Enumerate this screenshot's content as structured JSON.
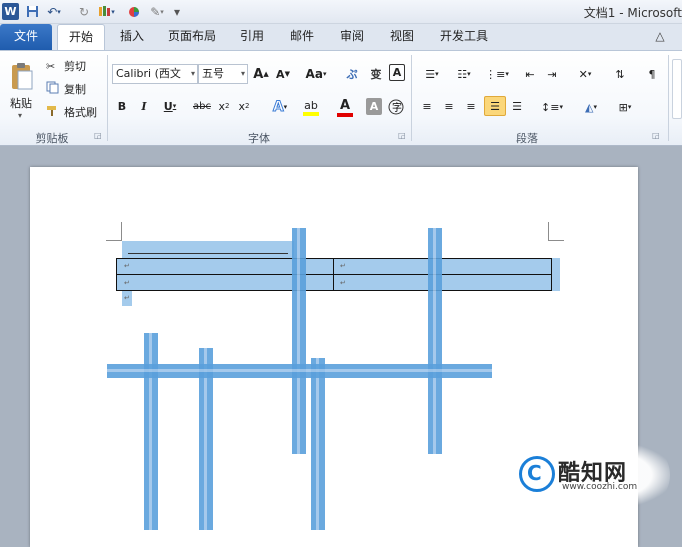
{
  "window": {
    "app_letter": "W",
    "title": "文档1 - Microsoft"
  },
  "tabs": [
    "文件",
    "开始",
    "插入",
    "页面布局",
    "引用",
    "邮件",
    "审阅",
    "视图",
    "开发工具"
  ],
  "ribbon": {
    "clipboard": {
      "paste": "粘贴",
      "cut": "剪切",
      "copy": "复制",
      "format_painter": "格式刷",
      "label": "剪贴板"
    },
    "font": {
      "font_name": "Calibri (西文",
      "font_size": "五号",
      "grow": "A",
      "shrink": "A",
      "change_case": "Aa",
      "bold": "B",
      "italic": "I",
      "underline": "U",
      "strike": "abc",
      "subscript": "x",
      "superscript": "x",
      "clear_format": "A",
      "label": "字体"
    },
    "paragraph": {
      "label": "段落"
    }
  },
  "watermark": {
    "name": "酷知网",
    "url": "www.coozhi.com"
  },
  "colors": {
    "file_tab": "#2b62b3",
    "selection": "#5aa0dc",
    "highlight_yellow": "#ffff00",
    "font_red": "#e00000",
    "watermark_blue": "#1b7fd8"
  }
}
